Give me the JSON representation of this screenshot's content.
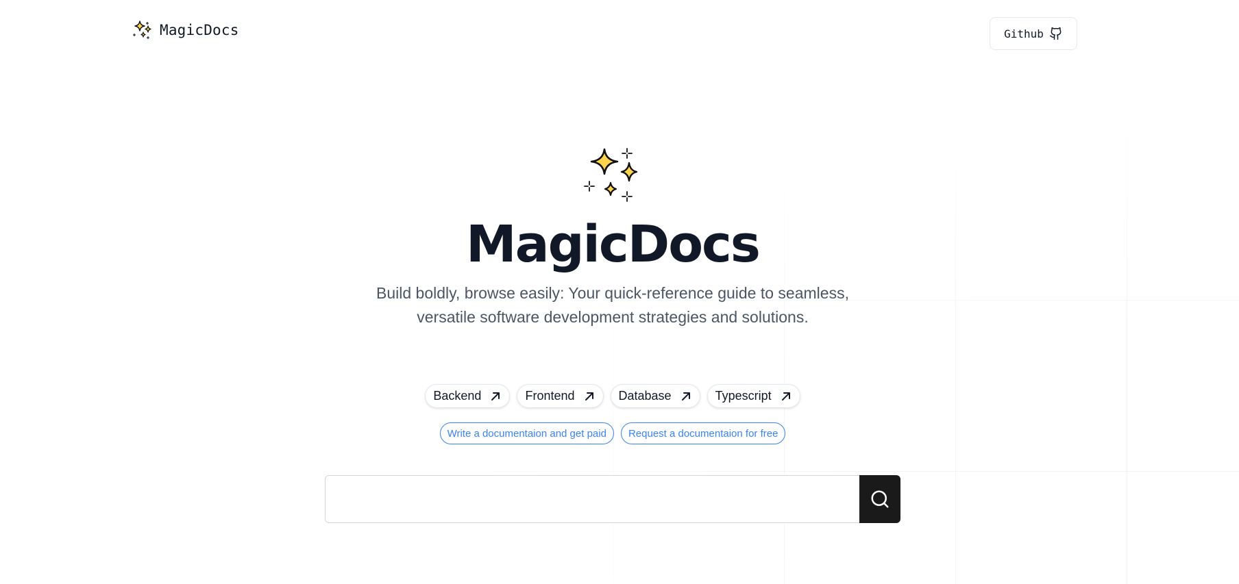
{
  "brand": {
    "name": "MagicDocs",
    "icon": "sparkles-icon"
  },
  "nav": {
    "github_label": "Github",
    "github_icon": "github-icon"
  },
  "hero": {
    "title": "MagicDocs",
    "subtitle_line1": "Build boldly, browse easily: Your quick-reference guide to seamless,",
    "subtitle_line2": "versatile software development strategies and solutions.",
    "icon": "sparkles-icon"
  },
  "categories": [
    {
      "label": "Backend",
      "icon": "arrow-up-right-icon"
    },
    {
      "label": "Frontend",
      "icon": "arrow-up-right-icon"
    },
    {
      "label": "Database",
      "icon": "arrow-up-right-icon"
    },
    {
      "label": "Typescript",
      "icon": "arrow-up-right-icon"
    }
  ],
  "links": [
    {
      "label": "Write a documentaion and get paid"
    },
    {
      "label": "Request a documentaion for free"
    }
  ],
  "search": {
    "value": "",
    "placeholder": "",
    "icon": "search-icon"
  },
  "colors": {
    "sparkle_fill": "#FCD34D",
    "link_blue": "#3B82F6",
    "search_button": "#1A1A1A",
    "title": "#111827"
  }
}
